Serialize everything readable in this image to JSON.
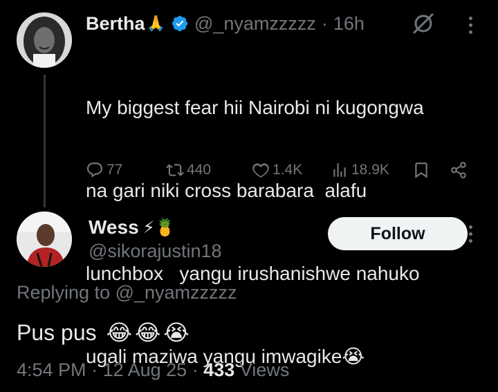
{
  "parent_tweet": {
    "display_name": "Bertha",
    "name_emoji": "🙏",
    "handle": "@_nyamzzzzz",
    "separator": "·",
    "time": "16h",
    "text_lines": [
      "My biggest fear hii Nairobi ni kugongwa",
      "na gari niki cross barabara  alafu",
      "lunchbox   yangu irushanishwe nahuko",
      "ugali maziwa yangu imwagike😭"
    ],
    "stats": {
      "replies": "77",
      "retweets": "440",
      "likes": "1.4K",
      "views": "18.9K"
    }
  },
  "reply_tweet": {
    "display_name": "Wess",
    "name_emojis": "⚡🍍",
    "handle": "@sikorajustin18",
    "follow_label": "Follow",
    "replying_prefix": "Replying to ",
    "replying_handle": "@_nyamzzzzz",
    "text": "Pus pus",
    "text_emojis": [
      "😂",
      "😂",
      "😭"
    ],
    "time": "4:54 PM",
    "date": "12 Aug 25",
    "views_count": "433",
    "views_label": "Views"
  },
  "colors": {
    "background": "#000000",
    "text_primary": "#e7e9ea",
    "text_secondary": "#71767b",
    "verified_blue": "#1d9bf0",
    "follow_bg": "#eff3f4",
    "thread_line": "#333639"
  },
  "icons": [
    "verified-badge-icon",
    "grok-icon",
    "more-icon",
    "reply-icon",
    "retweet-icon",
    "like-icon",
    "views-icon",
    "bookmark-icon",
    "share-icon"
  ]
}
